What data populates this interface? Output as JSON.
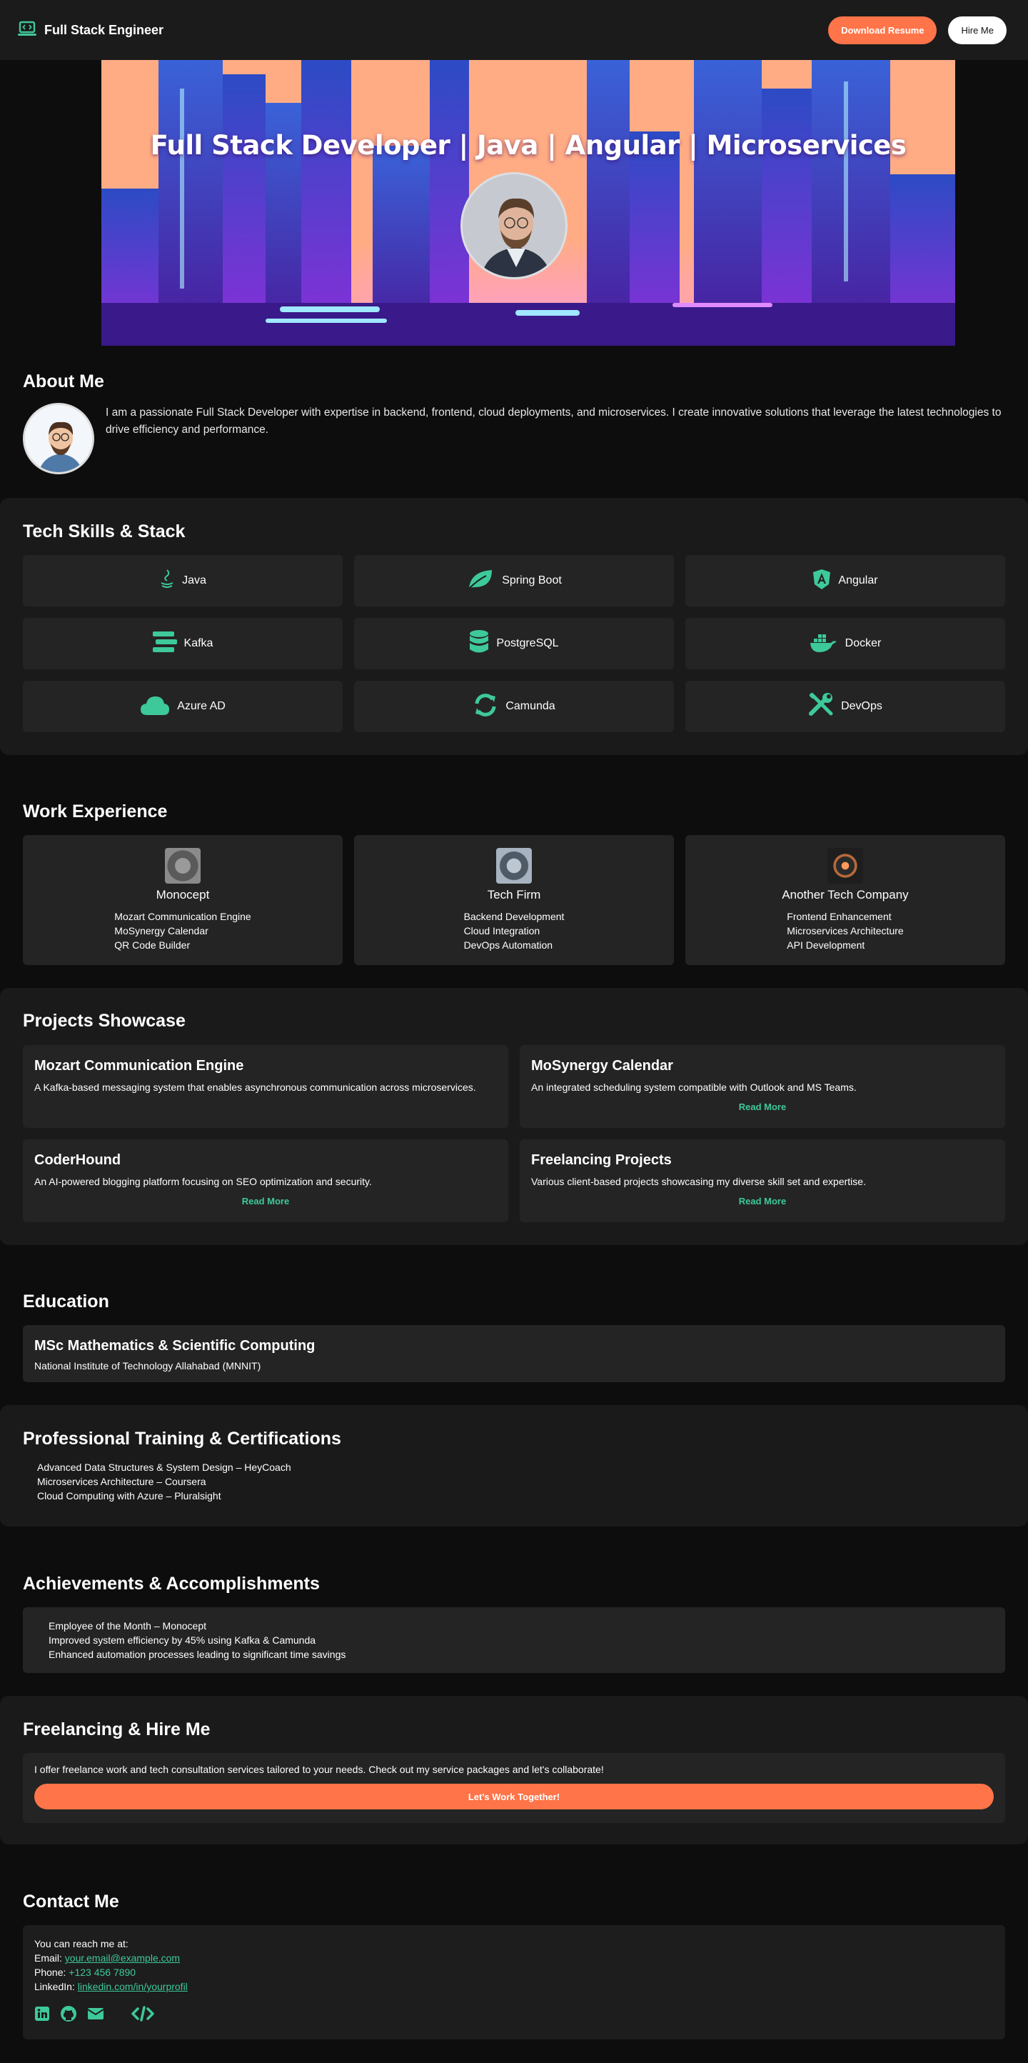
{
  "header": {
    "brand": "Full Stack Engineer",
    "download_label": "Download Resume",
    "hire_label": "Hire Me"
  },
  "hero": {
    "title": "Full Stack Developer | Java | Angular | Microservices"
  },
  "about": {
    "heading": "About Me",
    "text": "I am a passionate Full Stack Developer with expertise in backend, frontend, cloud deployments, and microservices. I create innovative solutions that leverage the latest technologies to drive efficiency and performance."
  },
  "skills": {
    "heading": "Tech Skills & Stack",
    "items": [
      {
        "label": "Java",
        "icon": "java-icon"
      },
      {
        "label": "Spring Boot",
        "icon": "leaf-icon"
      },
      {
        "label": "Angular",
        "icon": "angular-icon"
      },
      {
        "label": "Kafka",
        "icon": "stream-icon"
      },
      {
        "label": "PostgreSQL",
        "icon": "database-icon"
      },
      {
        "label": "Docker",
        "icon": "docker-icon"
      },
      {
        "label": "Azure AD",
        "icon": "cloud-icon"
      },
      {
        "label": "Camunda",
        "icon": "sync-icon"
      },
      {
        "label": "DevOps",
        "icon": "tools-icon"
      }
    ]
  },
  "experience": {
    "heading": "Work Experience",
    "companies": [
      {
        "name": "Monocept",
        "items": [
          "Mozart Communication Engine",
          "MoSynergy Calendar",
          "QR Code Builder"
        ]
      },
      {
        "name": "Tech Firm",
        "items": [
          "Backend Development",
          "Cloud Integration",
          "DevOps Automation"
        ]
      },
      {
        "name": "Another Tech Company",
        "items": [
          "Frontend Enhancement",
          "Microservices Architecture",
          "API Development"
        ]
      }
    ]
  },
  "projects": {
    "heading": "Projects Showcase",
    "read_more": "Read More",
    "items": [
      {
        "title": "Mozart Communication Engine",
        "desc": "A Kafka-based messaging system that enables asynchronous communication across microservices."
      },
      {
        "title": "MoSynergy Calendar",
        "desc": "An integrated scheduling system compatible with Outlook and MS Teams."
      },
      {
        "title": "CoderHound",
        "desc": "An AI-powered blogging platform focusing on SEO optimization and security."
      },
      {
        "title": "Freelancing Projects",
        "desc": "Various client-based projects showcasing my diverse skill set and expertise."
      }
    ]
  },
  "education": {
    "heading": "Education",
    "degree": "MSc Mathematics & Scientific Computing",
    "institute": "National Institute of Technology Allahabad (MNNIT)"
  },
  "training": {
    "heading": "Professional Training & Certifications",
    "items": [
      "Advanced Data Structures & System Design – HeyCoach",
      "Microservices Architecture – Coursera",
      "Cloud Computing with Azure – Pluralsight"
    ]
  },
  "achievements": {
    "heading": "Achievements & Accomplishments",
    "items": [
      "Employee of the Month – Monocept",
      "Improved system efficiency by 45% using Kafka & Camunda",
      "Enhanced automation processes leading to significant time savings"
    ]
  },
  "freelance": {
    "heading": "Freelancing & Hire Me",
    "text": "I offer freelance work and tech consultation services tailored to your needs. Check out my service packages and let's collaborate!",
    "cta": "Let's Work Together!"
  },
  "contact": {
    "heading": "Contact Me",
    "intro": "You can reach me at:",
    "email_label": "Email:",
    "email": "your.email@example.com",
    "phone_label": "Phone:",
    "phone": "+123 456 7890",
    "linkedin_label": "LinkedIn:",
    "linkedin": "linkedin.com/in/yourprofil",
    "socials": [
      "linkedin-icon",
      "github-icon",
      "envelope-icon",
      "code-icon"
    ]
  },
  "colors": {
    "accent": "#3ec99a",
    "orange": "#ff7448",
    "background": "#0d0d0d",
    "panel": "#1a1a1a",
    "card": "#242424"
  }
}
